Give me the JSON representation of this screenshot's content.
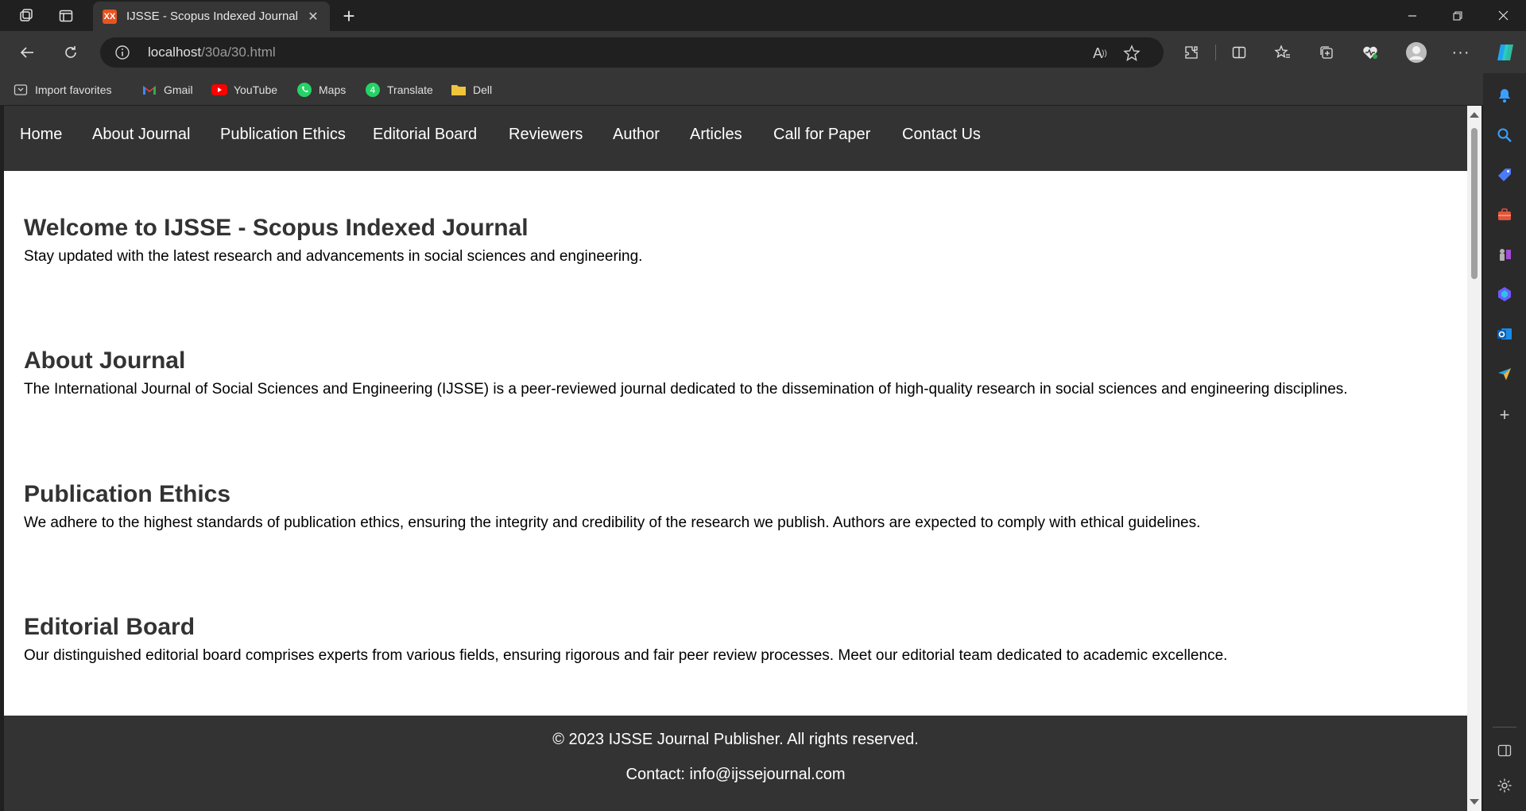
{
  "browser": {
    "tab_title": "IJSSE - Scopus Indexed Journal",
    "tab_favicon_text": "XX",
    "url_host": "localhost",
    "url_path": "/30a/30.html",
    "read_aloud_label": "A",
    "favorites": [
      {
        "label": "Import favorites",
        "icon": "import-icon"
      },
      {
        "label": "Gmail",
        "icon": "gmail-icon"
      },
      {
        "label": "YouTube",
        "icon": "youtube-icon"
      },
      {
        "label": "Maps",
        "icon": "whatsapp-icon"
      },
      {
        "label": "Translate",
        "icon": "whatsapp-icon"
      },
      {
        "label": "Dell",
        "icon": "folder-icon"
      }
    ],
    "colors": {
      "tab_favicon": "#e8531f",
      "accent": "#0a84ff"
    }
  },
  "page": {
    "nav": [
      "Home",
      "About Journal",
      "Publication Ethics",
      "Editorial Board",
      "Reviewers",
      "Author",
      "Articles",
      "Call for Paper",
      "Contact Us"
    ],
    "sections": [
      {
        "heading": "Welcome to IJSSE - Scopus Indexed Journal",
        "text": "Stay updated with the latest research and advancements in social sciences and engineering."
      },
      {
        "heading": "About Journal",
        "text": "The International Journal of Social Sciences and Engineering (IJSSE) is a peer-reviewed journal dedicated to the dissemination of high-quality research in social sciences and engineering disciplines."
      },
      {
        "heading": "Publication Ethics",
        "text": "We adhere to the highest standards of publication ethics, ensuring the integrity and credibility of the research we publish. Authors are expected to comply with ethical guidelines."
      },
      {
        "heading": "Editorial Board",
        "text": "Our distinguished editorial board comprises experts from various fields, ensuring rigorous and fair peer review processes. Meet our editorial team dedicated to academic excellence."
      }
    ],
    "footer": {
      "copyright": "© 2023 IJSSE Journal Publisher. All rights reserved.",
      "contact": "Contact: info@ijssejournal.com"
    },
    "colors": {
      "nav_bg": "#333333",
      "heading": "#333333"
    }
  }
}
